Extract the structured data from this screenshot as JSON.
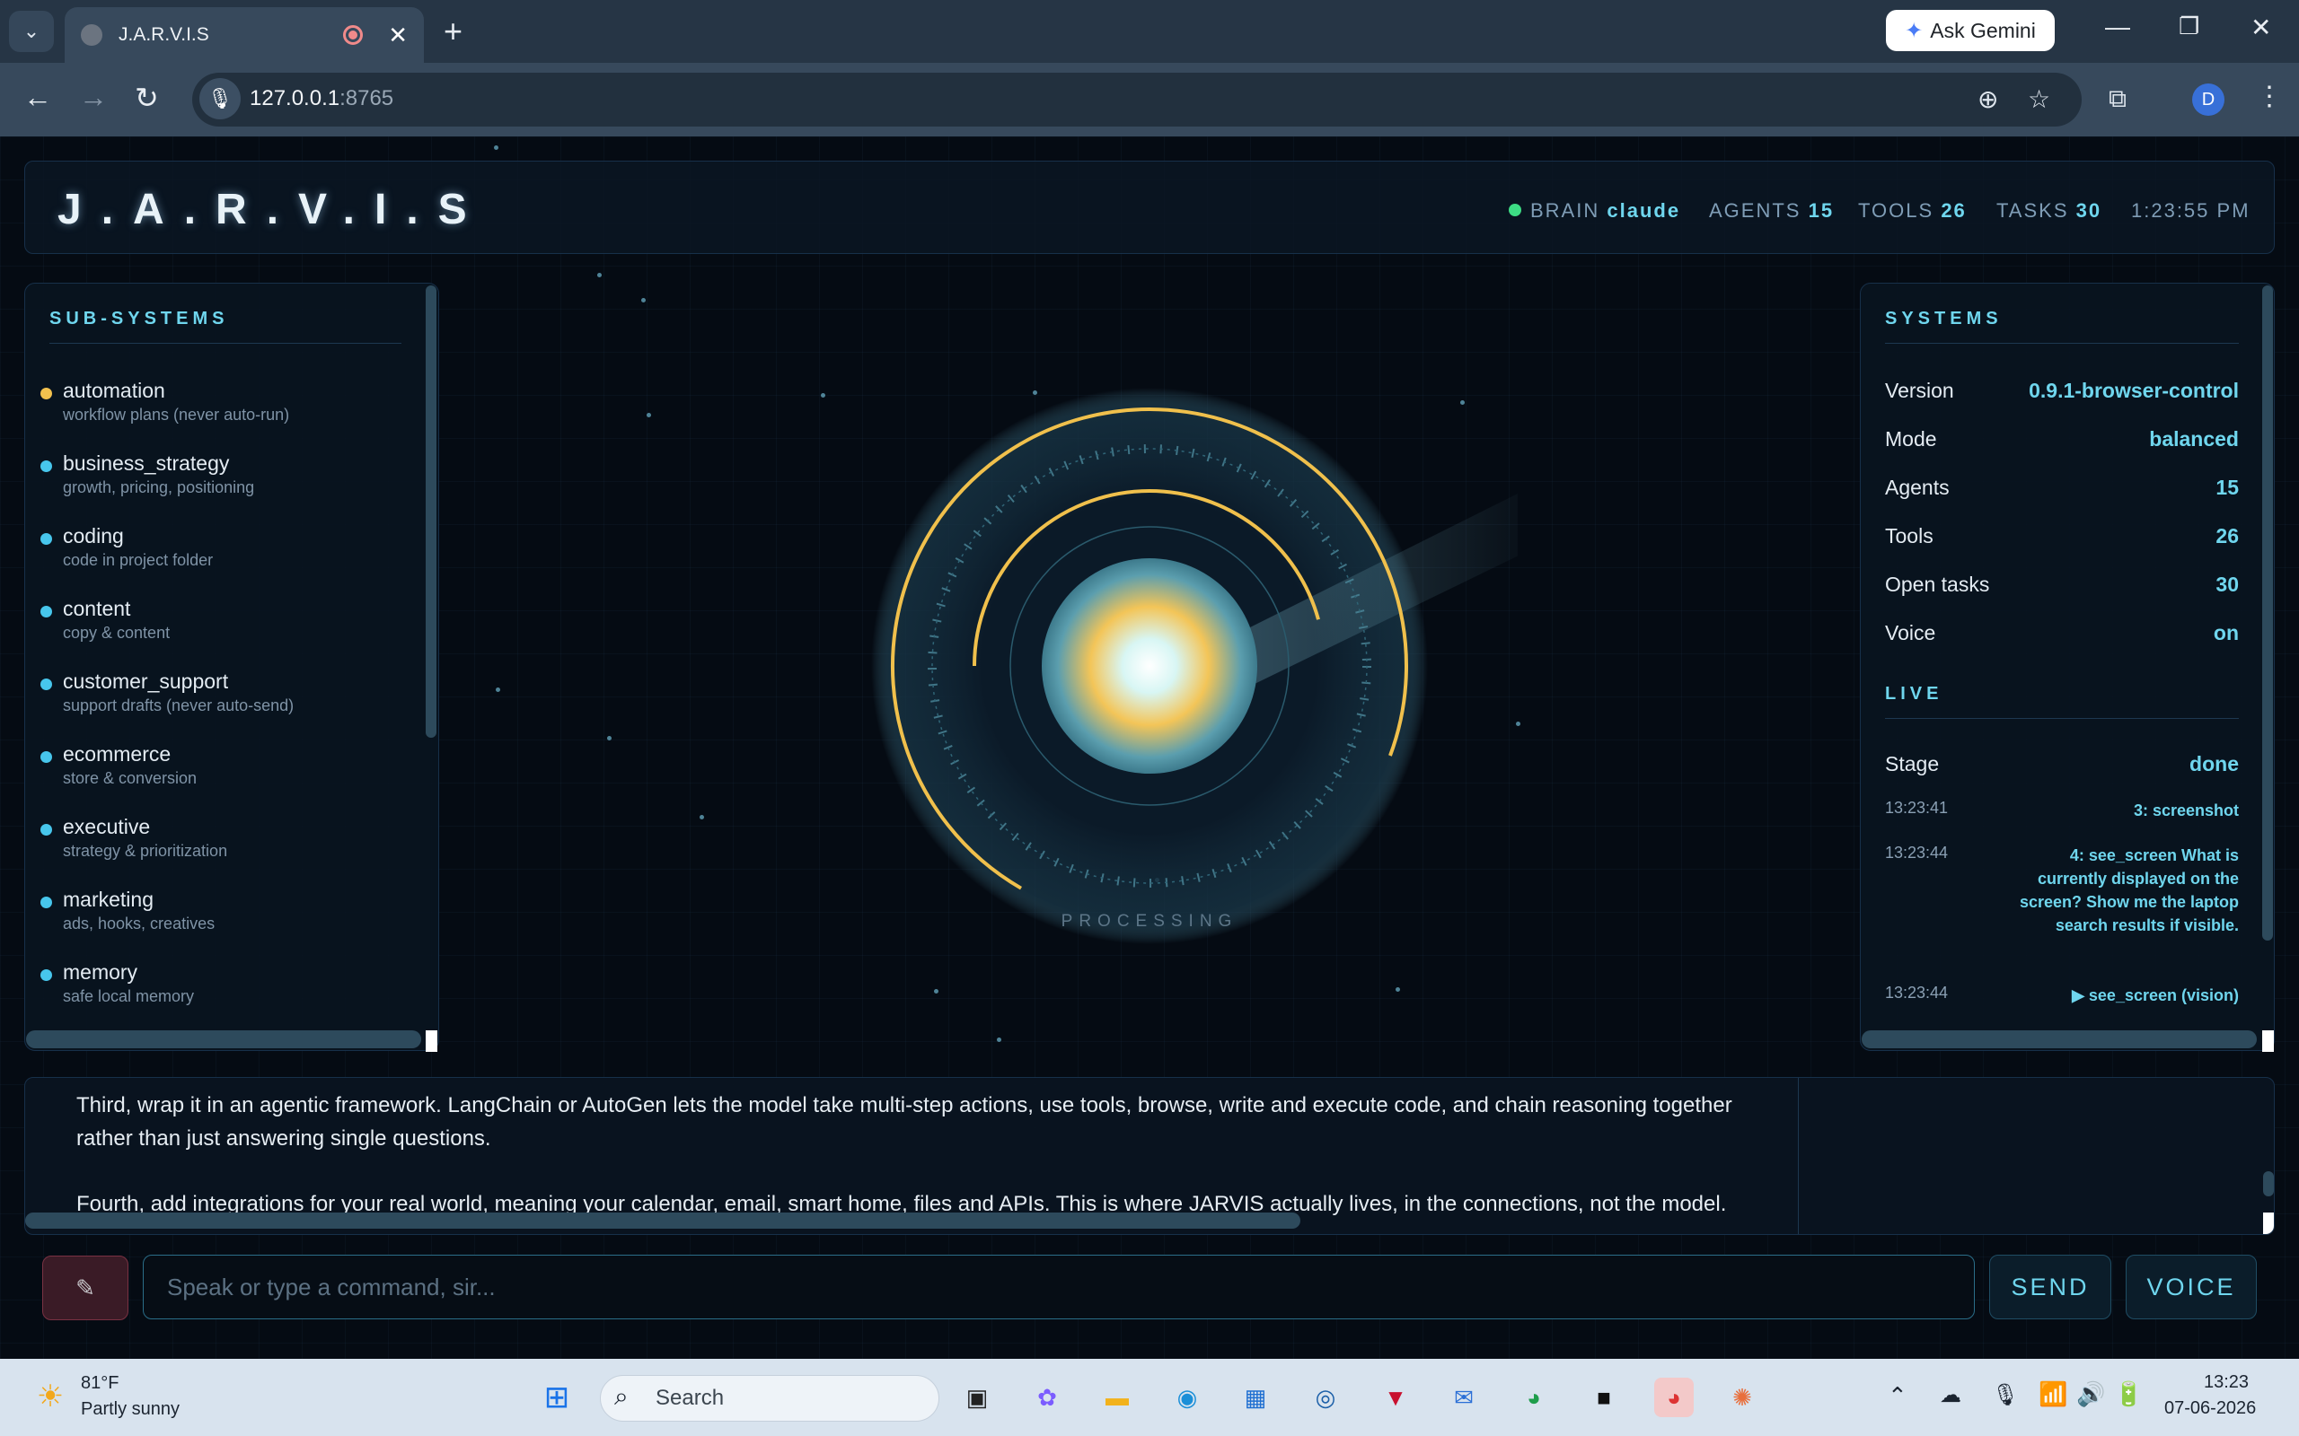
{
  "browser": {
    "tab_title": "J.A.R.V.I.S",
    "tab_dropdown_icon": "chevron-down",
    "new_tab_label": "+",
    "gemini_label": "Ask Gemini",
    "url_host": "127.0.0.1",
    "url_port": ":8765",
    "profile_initial": "D"
  },
  "header": {
    "logo": "J.A.R.V.I.S",
    "brain_label": "BRAIN",
    "brain_value": "claude",
    "agents_label": "AGENTS",
    "agents_value": "15",
    "tools_label": "TOOLS",
    "tools_value": "26",
    "tasks_label": "TASKS",
    "tasks_value": "30",
    "clock": "1:23:55 PM"
  },
  "subsystems": {
    "title": "SUB-SYSTEMS",
    "items": [
      {
        "name": "automation",
        "desc": "workflow plans (never auto-run)",
        "status_color": "#f2c14e"
      },
      {
        "name": "business_strategy",
        "desc": "growth, pricing, positioning",
        "status_color": "#47c6ec"
      },
      {
        "name": "coding",
        "desc": "code in project folder",
        "status_color": "#47c6ec"
      },
      {
        "name": "content",
        "desc": "copy & content",
        "status_color": "#47c6ec"
      },
      {
        "name": "customer_support",
        "desc": "support drafts (never auto-send)",
        "status_color": "#47c6ec"
      },
      {
        "name": "ecommerce",
        "desc": "store & conversion",
        "status_color": "#47c6ec"
      },
      {
        "name": "executive",
        "desc": "strategy & prioritization",
        "status_color": "#47c6ec"
      },
      {
        "name": "marketing",
        "desc": "ads, hooks, creatives",
        "status_color": "#47c6ec"
      },
      {
        "name": "memory",
        "desc": "safe local memory",
        "status_color": "#47c6ec"
      }
    ]
  },
  "core": {
    "status": "PROCESSING"
  },
  "systems": {
    "title": "SYSTEMS",
    "rows": [
      {
        "k": "Version",
        "v": "0.9.1-browser-control"
      },
      {
        "k": "Mode",
        "v": "balanced"
      },
      {
        "k": "Agents",
        "v": "15"
      },
      {
        "k": "Tools",
        "v": "26"
      },
      {
        "k": "Open tasks",
        "v": "30"
      },
      {
        "k": "Voice",
        "v": "on"
      }
    ],
    "live_title": "LIVE",
    "stage_label": "Stage",
    "stage_value": "done",
    "log": [
      {
        "t": "13:23:41",
        "m": "3: screenshot"
      },
      {
        "t": "13:23:44",
        "m": "4: see_screen What is currently displayed on the screen? Show me the laptop search results if visible."
      },
      {
        "t": "13:23:44",
        "m": "▶ see_screen (vision)"
      }
    ]
  },
  "chat": {
    "para1": "Third, wrap it in an agentic framework. LangChain or AutoGen lets the model take multi-step actions, use tools, browse, write and execute code, and chain reasoning together rather than just answering single questions.",
    "para2": "Fourth, add integrations for your real world, meaning your calendar, email, smart home, files and APIs. This is where JARVIS actually lives, in the connections, not the model."
  },
  "input": {
    "placeholder": "Speak or type a command, sir...",
    "send_label": "SEND",
    "voice_label": "VOICE"
  },
  "taskbar": {
    "weather_temp": "81°F",
    "weather_desc": "Partly sunny",
    "search_label": "Search",
    "time": "13:23",
    "date": "07-06-2026"
  }
}
